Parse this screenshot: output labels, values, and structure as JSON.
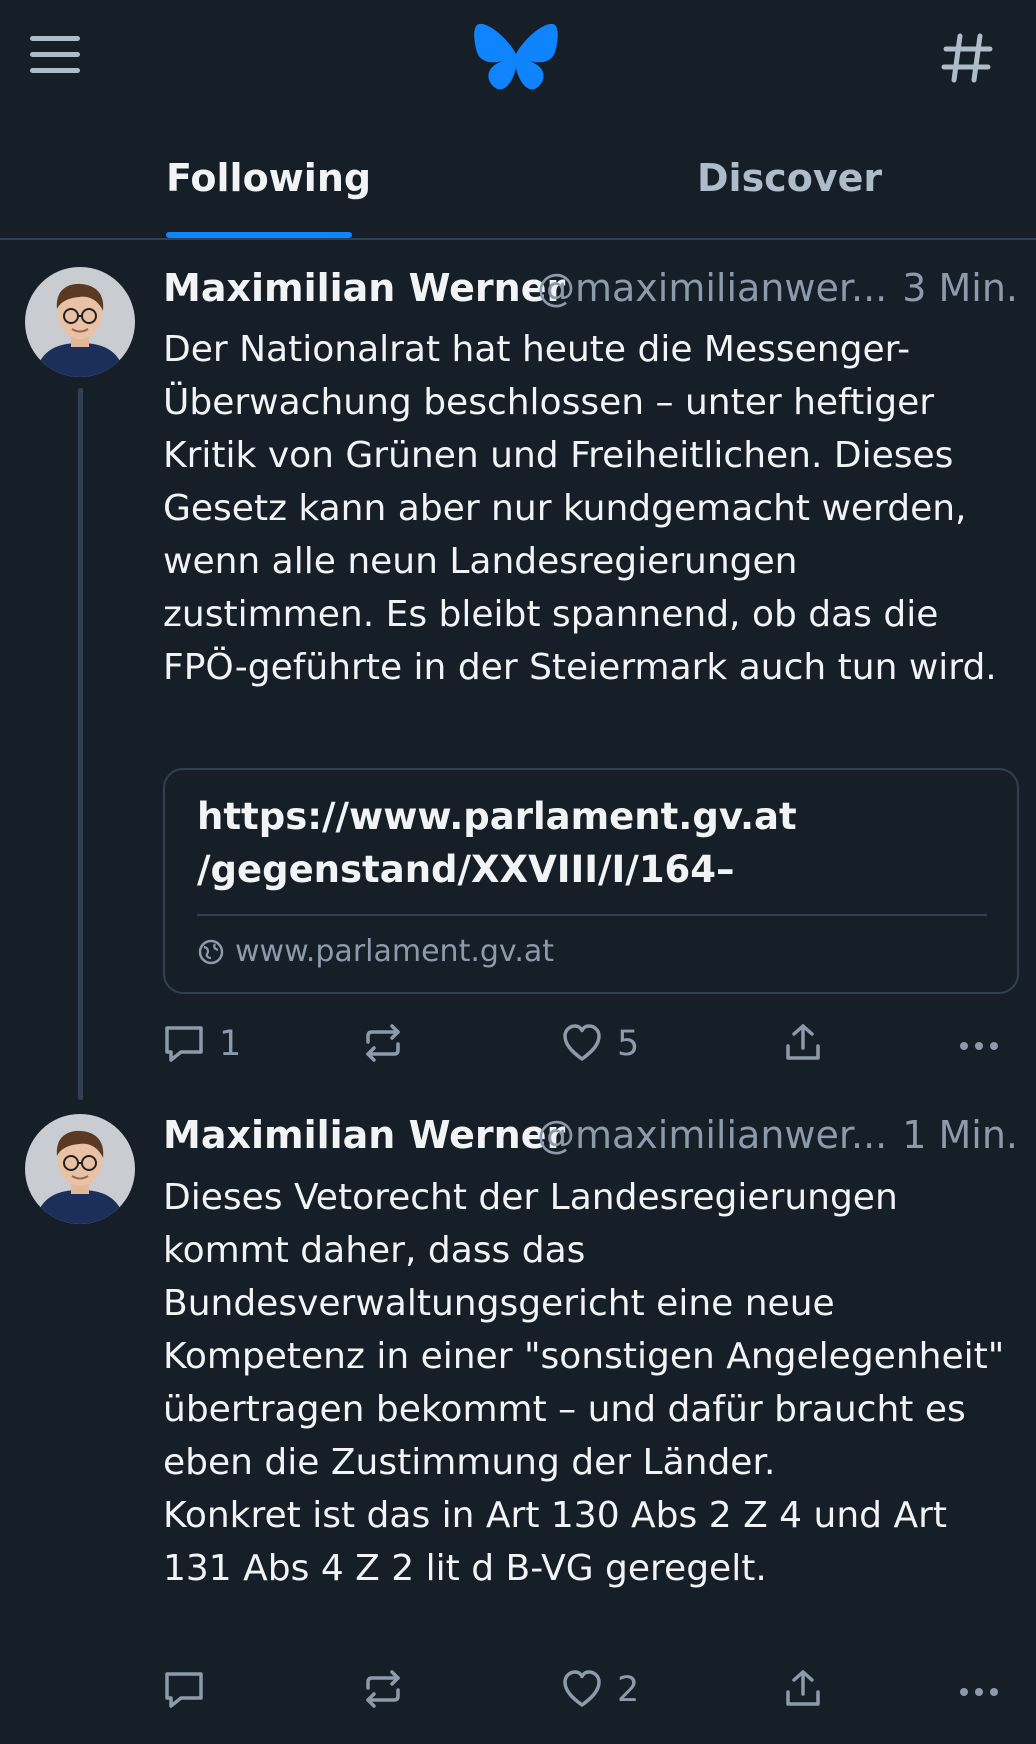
{
  "header": {
    "menu_icon": "hamburger-menu-icon",
    "logo_icon": "bluesky-butterfly-logo",
    "feeds_icon": "hashtag-icon",
    "accent_color": "#1083fe",
    "background_color": "#161e27"
  },
  "tabs": [
    {
      "label": "Following",
      "active": true
    },
    {
      "label": "Discover",
      "active": false
    }
  ],
  "posts": [
    {
      "author": "Maximilian Werner",
      "handle": "@maximilianwer...",
      "time": "3 Min.",
      "text": "Der Nationalrat hat heute die Messenger-Überwachung beschlossen – unter heftiger Kritik von Grünen und Freiheitlichen. Dieses Gesetz kann aber nur kundgemacht werden, wenn alle neun Landesregierungen zustimmen. Es bleibt spannend, ob das die FPÖ-geführte in der Steiermark auch tun wird.",
      "link_card": {
        "title": "https://www.parlament.gv.at /gegenstand/XXVIII/I/164–",
        "domain": "www.parlament.gv.at"
      },
      "actions": {
        "replies": "1",
        "reposts": "",
        "likes": "5"
      }
    },
    {
      "author": "Maximilian Werner",
      "handle": "@maximilianwer...",
      "time": "1 Min.",
      "text": "Dieses Vetorecht der Landesregierungen kommt daher, dass das Bundesverwaltungsgericht eine neue Kompetenz in einer \"sonstigen Angelegenheit\" übertragen bekommt – und dafür braucht es eben die Zustimmung der Länder.\nKonkret ist das in Art 130 Abs 2 Z 4 und Art 131 Abs 4 Z 2 lit d B-VG geregelt.",
      "actions": {
        "replies": "",
        "reposts": "",
        "likes": "2"
      }
    }
  ]
}
